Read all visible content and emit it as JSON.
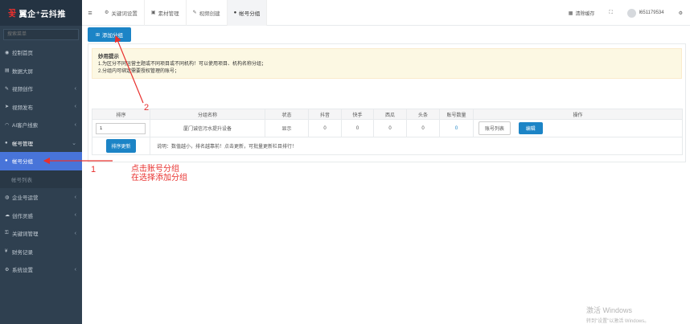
{
  "brand": {
    "logo_mark": "꽃",
    "logo_text": "翼企⁺云抖推"
  },
  "sidebar": {
    "search_placeholder": "搜索菜单",
    "items": [
      {
        "label": "控制首页",
        "icon": "gauge-icon",
        "glyph": "◉"
      },
      {
        "label": "数据大屏",
        "icon": "monitor-icon",
        "glyph": "▤"
      },
      {
        "label": "视频创作",
        "icon": "pencil-icon",
        "glyph": "✎"
      },
      {
        "label": "视频发布",
        "icon": "send-icon",
        "glyph": "➤"
      },
      {
        "label": "AI客户线索",
        "icon": "wifi-icon",
        "glyph": "◠"
      },
      {
        "label": "帐号管理",
        "icon": "users-icon",
        "glyph": "●"
      },
      {
        "label": "帐号分组",
        "icon": "user-icon",
        "glyph": "●"
      },
      {
        "label": "帐号列表",
        "icon": "",
        "glyph": ""
      },
      {
        "label": "企业号运营",
        "icon": "headset-icon",
        "glyph": "◍"
      },
      {
        "label": "创作灵感",
        "icon": "cloud-icon",
        "glyph": "☁"
      },
      {
        "label": "关键词管理",
        "icon": "key-icon",
        "glyph": "⚿"
      },
      {
        "label": "财务记录",
        "icon": "yen-icon",
        "glyph": "¥"
      },
      {
        "label": "系统设置",
        "icon": "gear-icon",
        "glyph": "⚙"
      }
    ]
  },
  "topbar": {
    "menu_glyph": "≡",
    "tabs": [
      {
        "label": "关键词设置",
        "glyph": "⚙"
      },
      {
        "label": "素材管理",
        "glyph": "▣"
      },
      {
        "label": "视频创建",
        "glyph": "✎"
      },
      {
        "label": "帐号分组",
        "glyph": "●"
      }
    ],
    "clear_cache_label": "清除缓存",
    "clear_cache_glyph": "▦",
    "fullscreen_glyph": "⛶",
    "username": "l651179534",
    "settings_glyph": "⚙"
  },
  "main": {
    "add_group_label": "添加分组",
    "add_group_glyph": "⊞",
    "tips": {
      "title": "妙用提示",
      "line1": "1.为区分不同运营主题或不同项目或不同机构！可以使用项目、机构名称分组；",
      "line2": "2.分组内可绑定需要授权管理的账号；"
    },
    "table": {
      "headers": [
        "排序",
        "分组名称",
        "状态",
        "抖音",
        "快手",
        "西瓜",
        "头条",
        "账号数量",
        "操作"
      ],
      "row": {
        "sort": "1",
        "name": "厦门诚信污水提升设备",
        "status": "显示",
        "douyin": "0",
        "kuaishou": "0",
        "xigua": "0",
        "toutiao": "0",
        "account_count": "0",
        "account_list_label": "账号列表",
        "edit_label": "编辑"
      },
      "sort_update_label": "排序更新",
      "note": "说明：数值越小，排名越靠前！点击更新，可批量更新栏目排行！"
    }
  },
  "annotations": {
    "num1": "1",
    "num2": "2",
    "text_line1": "点击账号分组",
    "text_line2": "在选择添加分组"
  },
  "watermark": {
    "line1": "激活 Windows",
    "line2": "转到\"设置\"以激活 Windows。"
  }
}
